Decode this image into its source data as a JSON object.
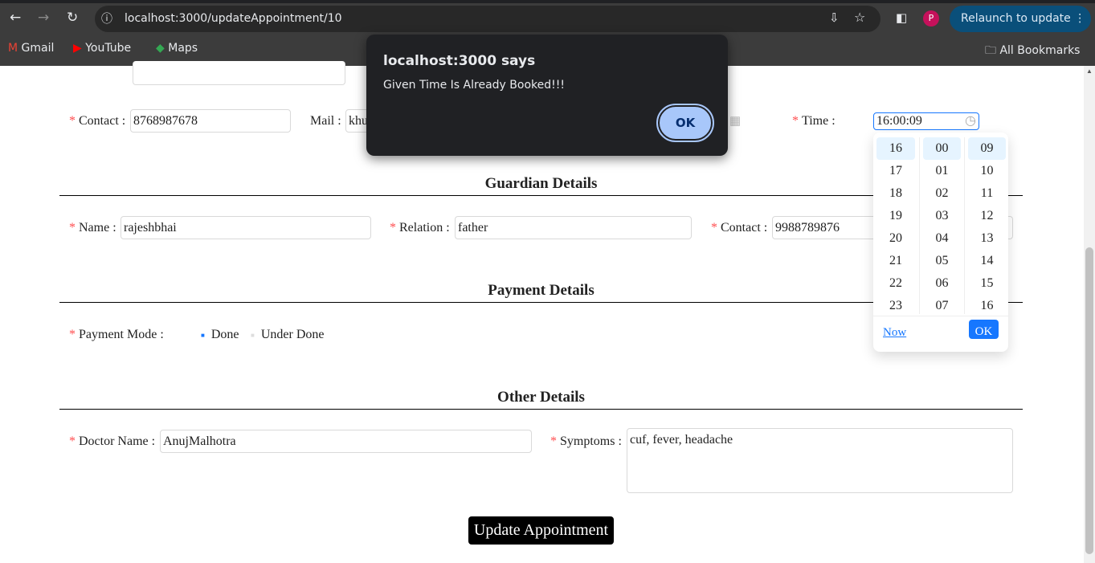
{
  "browser": {
    "url": "localhost:3000/updateAppointment/10",
    "relaunch_label": "Relaunch to update",
    "profile_initial": "P",
    "bookmarks": [
      "Gmail",
      "YouTube",
      "Maps"
    ],
    "all_bookmarks": "All Bookmarks"
  },
  "dialog": {
    "title": "localhost:3000 says",
    "message": "Given Time Is Already Booked!!!",
    "ok": "OK"
  },
  "form": {
    "contact_label": "Contact",
    "contact_value": "8768987678",
    "mail_label": "Mail",
    "mail_value": "khu",
    "time_label": "Time",
    "time_value": "16:00:09",
    "guardian_title": "Guardian Details",
    "g_name_label": "Name",
    "g_name_value": "rajeshbhai",
    "g_relation_label": "Relation",
    "g_relation_value": "father",
    "g_contact_label": "Contact",
    "g_contact_value": "9988789876",
    "payment_title": "Payment Details",
    "payment_mode_label": "Payment Mode",
    "payment_options": [
      "Done",
      "Under Done"
    ],
    "other_title": "Other Details",
    "doctor_label": "Doctor Name",
    "doctor_value": "AnujMalhotra",
    "symptoms_label": "Symptoms",
    "symptoms_value": "cuf, fever, headache",
    "submit": "Update Appointment"
  },
  "time_picker": {
    "hours": [
      "16",
      "17",
      "18",
      "19",
      "20",
      "21",
      "22",
      "23"
    ],
    "minutes": [
      "00",
      "01",
      "02",
      "03",
      "04",
      "05",
      "06",
      "07"
    ],
    "seconds": [
      "09",
      "10",
      "11",
      "12",
      "13",
      "14",
      "15",
      "16"
    ],
    "now": "Now",
    "ok": "OK"
  },
  "colors": {
    "accent": "#1677ff",
    "required": "#ff4d4f",
    "dialog_bg": "#202124"
  }
}
